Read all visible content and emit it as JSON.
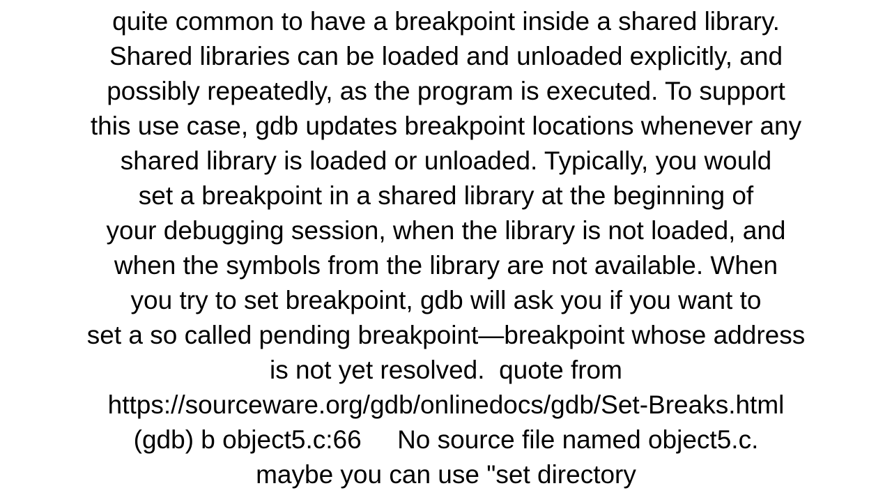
{
  "doc": {
    "lines": [
      "quite common to have a breakpoint inside a shared library.",
      "Shared libraries can be loaded and unloaded explicitly, and",
      "possibly repeatedly, as the program is executed. To support",
      "this use case, gdb updates breakpoint locations whenever any",
      "shared library is loaded or unloaded. Typically, you would",
      "set a breakpoint in a shared library at the beginning of",
      "your debugging session, when the library is not loaded, and",
      "when the symbols from the library are not available. When",
      "you try to set breakpoint, gdb will ask you if you want to",
      "set a so called pending breakpoint—breakpoint whose address",
      "is not yet resolved.  quote from",
      "https://sourceware.org/gdb/onlinedocs/gdb/Set-Breaks.html",
      "(gdb) b object5.c:66     No source file named object5.c.",
      "maybe you can use \"set directory"
    ]
  }
}
